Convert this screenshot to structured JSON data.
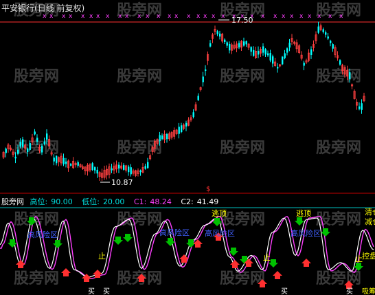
{
  "header": {
    "symbol": "平安银行",
    "period": "(日线 前复权)"
  },
  "indicator_bar": {
    "name": "股旁网",
    "high_label": "高位:",
    "high_value": "90.00",
    "low_label": "低位:",
    "low_value": "20.00",
    "c1_label": "C1:",
    "c1_value": "48.24",
    "c2_label": "C2:",
    "c2_value": "41.49"
  },
  "watermark": "股旁网",
  "colors": {
    "up": "#ff4040",
    "down": "#00ffff",
    "top_line": "#ff3030",
    "separator": "#c00000",
    "marker": "#ff40ff",
    "c1": "#ff40ff",
    "c2": "#ffffff",
    "zone_text": "#4060ff",
    "escape_text": "#ffff00",
    "stop_text": "#ffff00",
    "buy_arrow": "#ff3030",
    "sell_arrow": "#00c000"
  },
  "chart_data": [
    {
      "type": "candlestick",
      "title": "平安银行(日线 前复权)",
      "annotations": [
        {
          "label": "17.50",
          "kind": "high"
        },
        {
          "label": "10.87",
          "kind": "low"
        }
      ],
      "top_markers": "x",
      "marker_symbol": "x"
    },
    {
      "type": "line",
      "ylim": [
        0,
        100
      ],
      "levels": {
        "high": 90,
        "low": 20
      },
      "series": [
        {
          "name": "C1",
          "last_value": 48.24
        },
        {
          "name": "C2",
          "last_value": 41.49
        }
      ],
      "signals": {
        "zone": "高风险区",
        "escape": "逃顶",
        "stop": "止",
        "bottom": "买",
        "right_labels": [
          "清仓",
          "减仓",
          "控盘",
          "吸筹"
        ]
      }
    }
  ]
}
